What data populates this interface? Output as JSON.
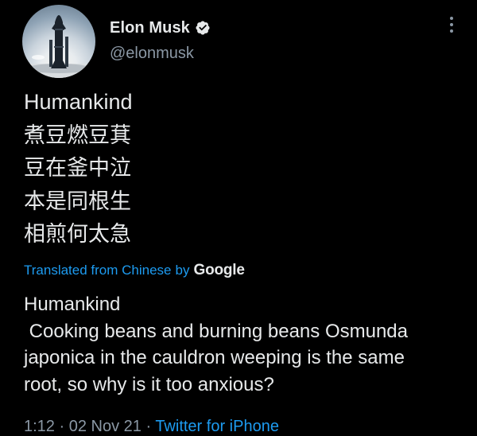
{
  "author": {
    "display_name": "Elon Musk",
    "handle": "@elonmusk",
    "verified": true,
    "avatar_icon": "starship-rocket-avatar"
  },
  "menu_icon": "more-options-vertical-icon",
  "tweet": {
    "original_lines": [
      "Humankind",
      "煮豆燃豆萁",
      "豆在釜中泣",
      "本是同根生",
      "相煎何太急"
    ],
    "translated_from": "Translated from Chinese",
    "by": "by",
    "translator": "Google",
    "translation_lines": [
      "Humankind",
      " Cooking beans and burning beans Osmunda",
      "japonica in the cauldron weeping is the same",
      "root, so why is it too anxious?"
    ]
  },
  "meta": {
    "time": "1:12",
    "separator": " · ",
    "date": "02 Nov 21",
    "source": "Twitter for iPhone"
  },
  "colors": {
    "background": "#000000",
    "text_primary": "#e7e9ea",
    "text_secondary": "#8b98a5",
    "link": "#1d9bf0"
  }
}
